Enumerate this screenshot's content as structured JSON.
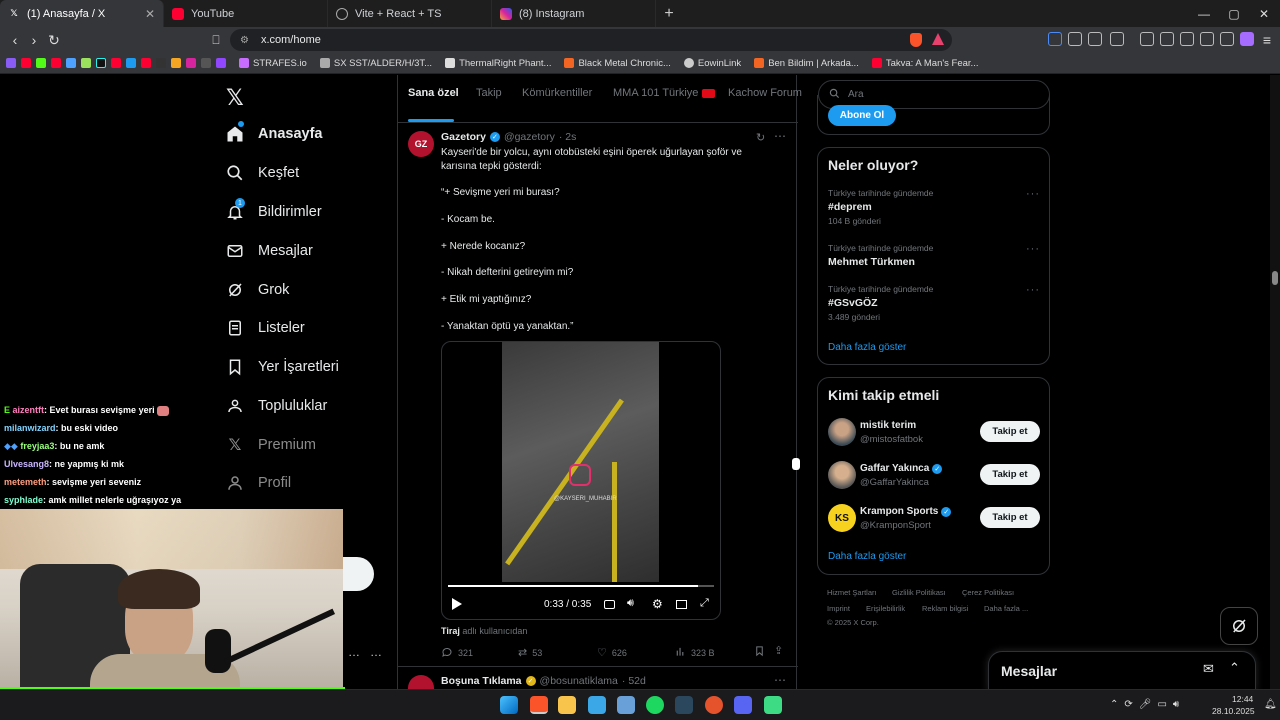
{
  "browser": {
    "tabs": [
      {
        "label": "(1) Anasayfa / X",
        "active": true
      },
      {
        "label": "YouTube",
        "active": false
      },
      {
        "label": "Vite + React + TS",
        "active": false
      },
      {
        "label": "(8) Instagram",
        "active": false
      }
    ],
    "url": "x.com/home",
    "bookmarks": [
      "STRAFES.io",
      "SX SST/ALDER/H/3T...",
      "ThermalRight Phant...",
      "Black Metal Chronic...",
      "EowinLink",
      "Ben Bildim | Arkada...",
      "Takva: A Man's Fear..."
    ]
  },
  "sidebar": {
    "items": [
      {
        "label": "Anasayfa",
        "icon": "home-icon"
      },
      {
        "label": "Keşfet",
        "icon": "search-icon"
      },
      {
        "label": "Bildirimler",
        "icon": "bell-icon",
        "badge": "1"
      },
      {
        "label": "Mesajlar",
        "icon": "mail-icon"
      },
      {
        "label": "Grok",
        "icon": "grok-icon"
      },
      {
        "label": "Listeler",
        "icon": "list-icon"
      },
      {
        "label": "Yer İşaretleri",
        "icon": "bookmark-icon"
      },
      {
        "label": "Topluluklar",
        "icon": "communities-icon"
      },
      {
        "label": "Premium",
        "icon": "x-icon"
      },
      {
        "label": "Profil",
        "icon": "person-icon"
      }
    ]
  },
  "feed": {
    "tabs": [
      "Sana özel",
      "Takip",
      "Kömürkentiller",
      "MMA 101 Türkiye",
      "Kachow Forum"
    ],
    "tweet": {
      "avatar_text": "GZ",
      "author": "Gazetory",
      "handle": "@gazetory",
      "time": "· 2s",
      "text_lines": [
        "Kayseri'de bir yolcu, aynı otobüsteki eşini öperek uğurlayan şoför ve",
        "karısına tepki gösterdi:"
      ],
      "dialog": [
        "“+ Sevişme yeri mi burası?",
        "- Kocam be.",
        "+ Nerede kocanız?",
        "- Nikah defterini getireyim mi?",
        "+ Etik mi yaptığınız?",
        "- Yanaktan öptü ya yanaktan.”"
      ],
      "video": {
        "watermark": "@KAYSERI_MUHABIR",
        "time": "0:33 / 0:35",
        "progress": 0.94
      },
      "source_name": "Tiraj",
      "source_suffix": "adlı kullanıcıdan",
      "metrics": {
        "replies": "321",
        "retweets": "53",
        "likes": "626",
        "views": "323 B"
      }
    },
    "next_tweet": {
      "author": "Boşuna Tıklama",
      "handle": "@bosunatiklama",
      "time": "· 52d"
    }
  },
  "right": {
    "search_placeholder": "Ara",
    "subscribe_label": "Abone Ol",
    "trends_title": "Neler oluyor?",
    "trends": [
      {
        "category": "Türkiye tarihinde gündemde",
        "name": "#deprem",
        "count": "104 B gönderi"
      },
      {
        "category": "Türkiye tarihinde gündemde",
        "name": "Mehmet Türkmen",
        "count": ""
      },
      {
        "category": "Türkiye tarihinde gündemde",
        "name": "#GSvGÖZ",
        "count": "3.489 gönderi"
      }
    ],
    "show_more": "Daha fazla göster",
    "wtf_title": "Kimi takip etmeli",
    "who_to_follow": [
      {
        "name": "mistik terim",
        "handle": "@mistosfatbok",
        "verified": false
      },
      {
        "name": "Gaffar Yakınca",
        "handle": "@GaffarYakinca",
        "verified": true
      },
      {
        "name": "Krampon Sports",
        "handle": "@KramponSport",
        "verified": true
      }
    ],
    "follow_label": "Takip et",
    "footer": [
      "Hizmet Şartları",
      "Gizlilik Politikası",
      "Çerez Politikası",
      "Imprint",
      "Erişilebilirlik",
      "Reklam bilgisi",
      "Daha fazla ...",
      "© 2025 X Corp."
    ],
    "messages_title": "Mesajlar"
  },
  "chat": [
    {
      "user": "aizentft",
      "text": ": Evet burası sevişme yeri",
      "color": "#ff7fbf"
    },
    {
      "user": "milanwizard",
      "text": ": bu eski video",
      "color": "#7fd3ff"
    },
    {
      "user": "freyjaa3",
      "text": ": bu ne amk",
      "color": "#9aff7f"
    },
    {
      "user": "Ulvesang8",
      "text": ": ne yapmış ki mk",
      "color": "#c9b6ff"
    },
    {
      "user": "metemeth",
      "text": ": sevişme yeri seveniz",
      "color": "#ff9d7f"
    },
    {
      "user": "syphlade",
      "text": ": amk millet nelerle uğraşıyoz ya",
      "color": "#7fffd4"
    }
  ],
  "taskbar": {
    "time": "12:44",
    "date": "28.10.2025"
  }
}
